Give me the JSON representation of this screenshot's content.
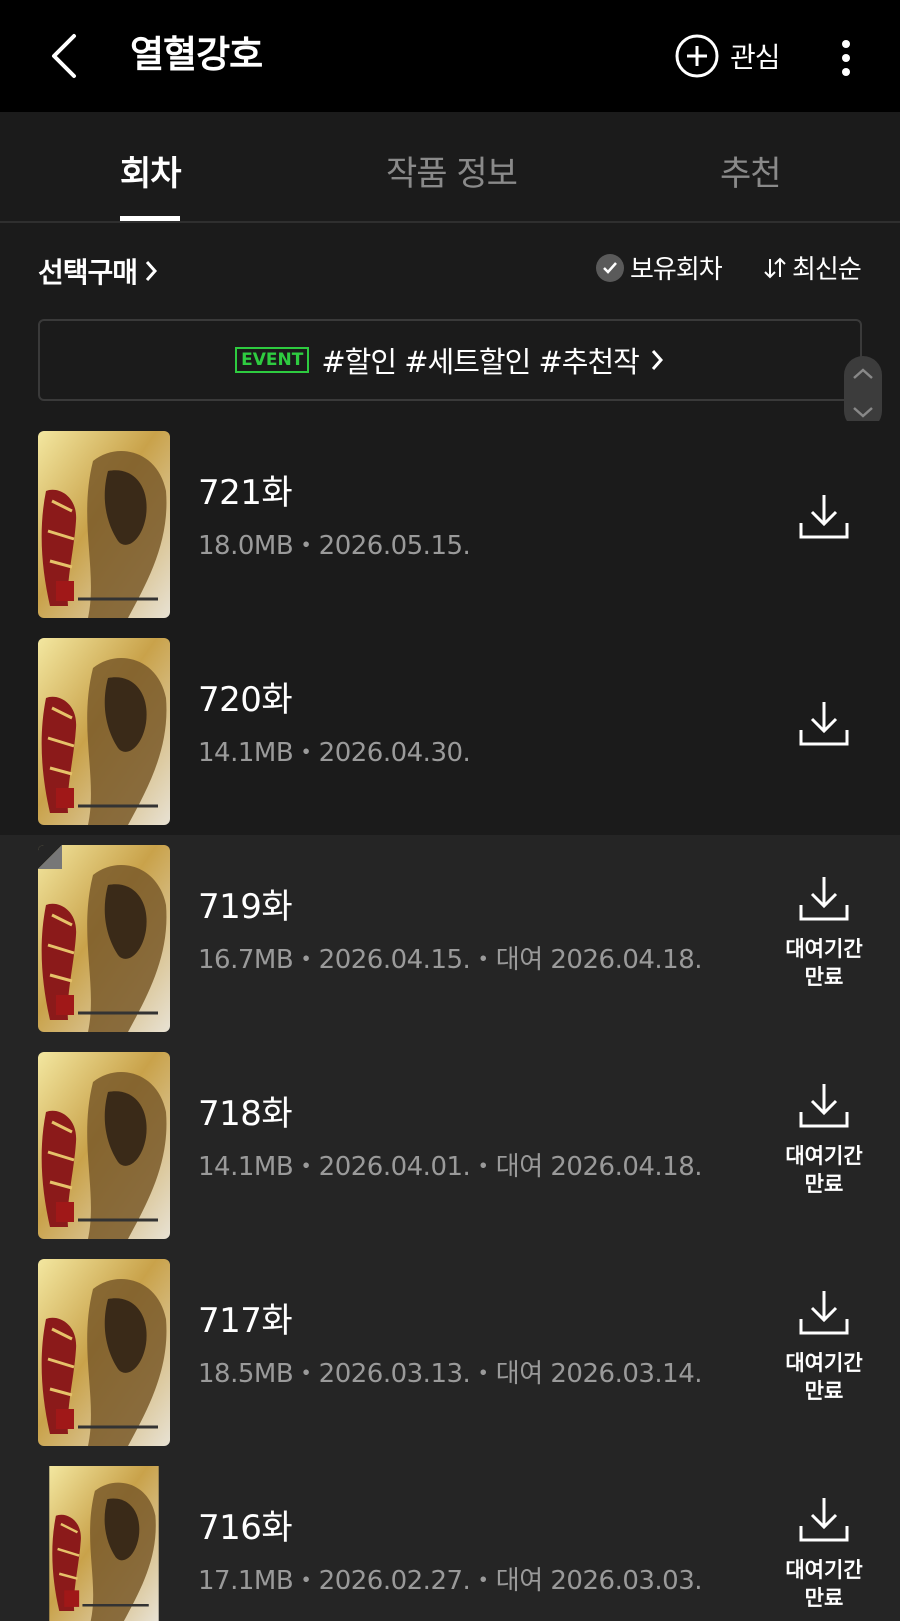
{
  "appbar": {
    "title": "열혈강호",
    "favorite_label": "관심"
  },
  "tabs": [
    "회차",
    "작품 정보",
    "추천"
  ],
  "filter": {
    "select_buy": "선택구매",
    "owned": "보유회차",
    "sort": "최신순"
  },
  "event": {
    "tag": "EVENT",
    "text": "#할인 #세트할인 #추천작"
  },
  "episodes": [
    {
      "title": "721화",
      "meta": "18.0MB・2026.05.15.",
      "rental": false
    },
    {
      "title": "720화",
      "meta": "14.1MB・2026.04.30.",
      "rental": false
    },
    {
      "title": "719화",
      "meta": "16.7MB・2026.04.15.・대여 2026.04.18.",
      "rental": true,
      "expire_line1": "대여기간",
      "expire_line2": "만료"
    },
    {
      "title": "718화",
      "meta": "14.1MB・2026.04.01.・대여 2026.04.18.",
      "rental": true,
      "expire_line1": "대여기간",
      "expire_line2": "만료"
    },
    {
      "title": "717화",
      "meta": "18.5MB・2026.03.13.・대여 2026.03.14.",
      "rental": true,
      "expire_line1": "대여기간",
      "expire_line2": "만료"
    },
    {
      "title": "716화",
      "meta": "17.1MB・2026.02.27.・대여 2026.03.03.",
      "rental": true,
      "expire_line1": "대여기간",
      "expire_line2": "만료"
    }
  ],
  "colors": {
    "event_green": "#2ecc40",
    "rented_bg": "#252525"
  },
  "icons": [
    "back-arrow-icon",
    "plus-circle-icon",
    "more-vert-icon",
    "chevron-right-icon",
    "check-icon",
    "sort-icon",
    "download-icon",
    "scroll-up-icon",
    "scroll-down-icon"
  ]
}
